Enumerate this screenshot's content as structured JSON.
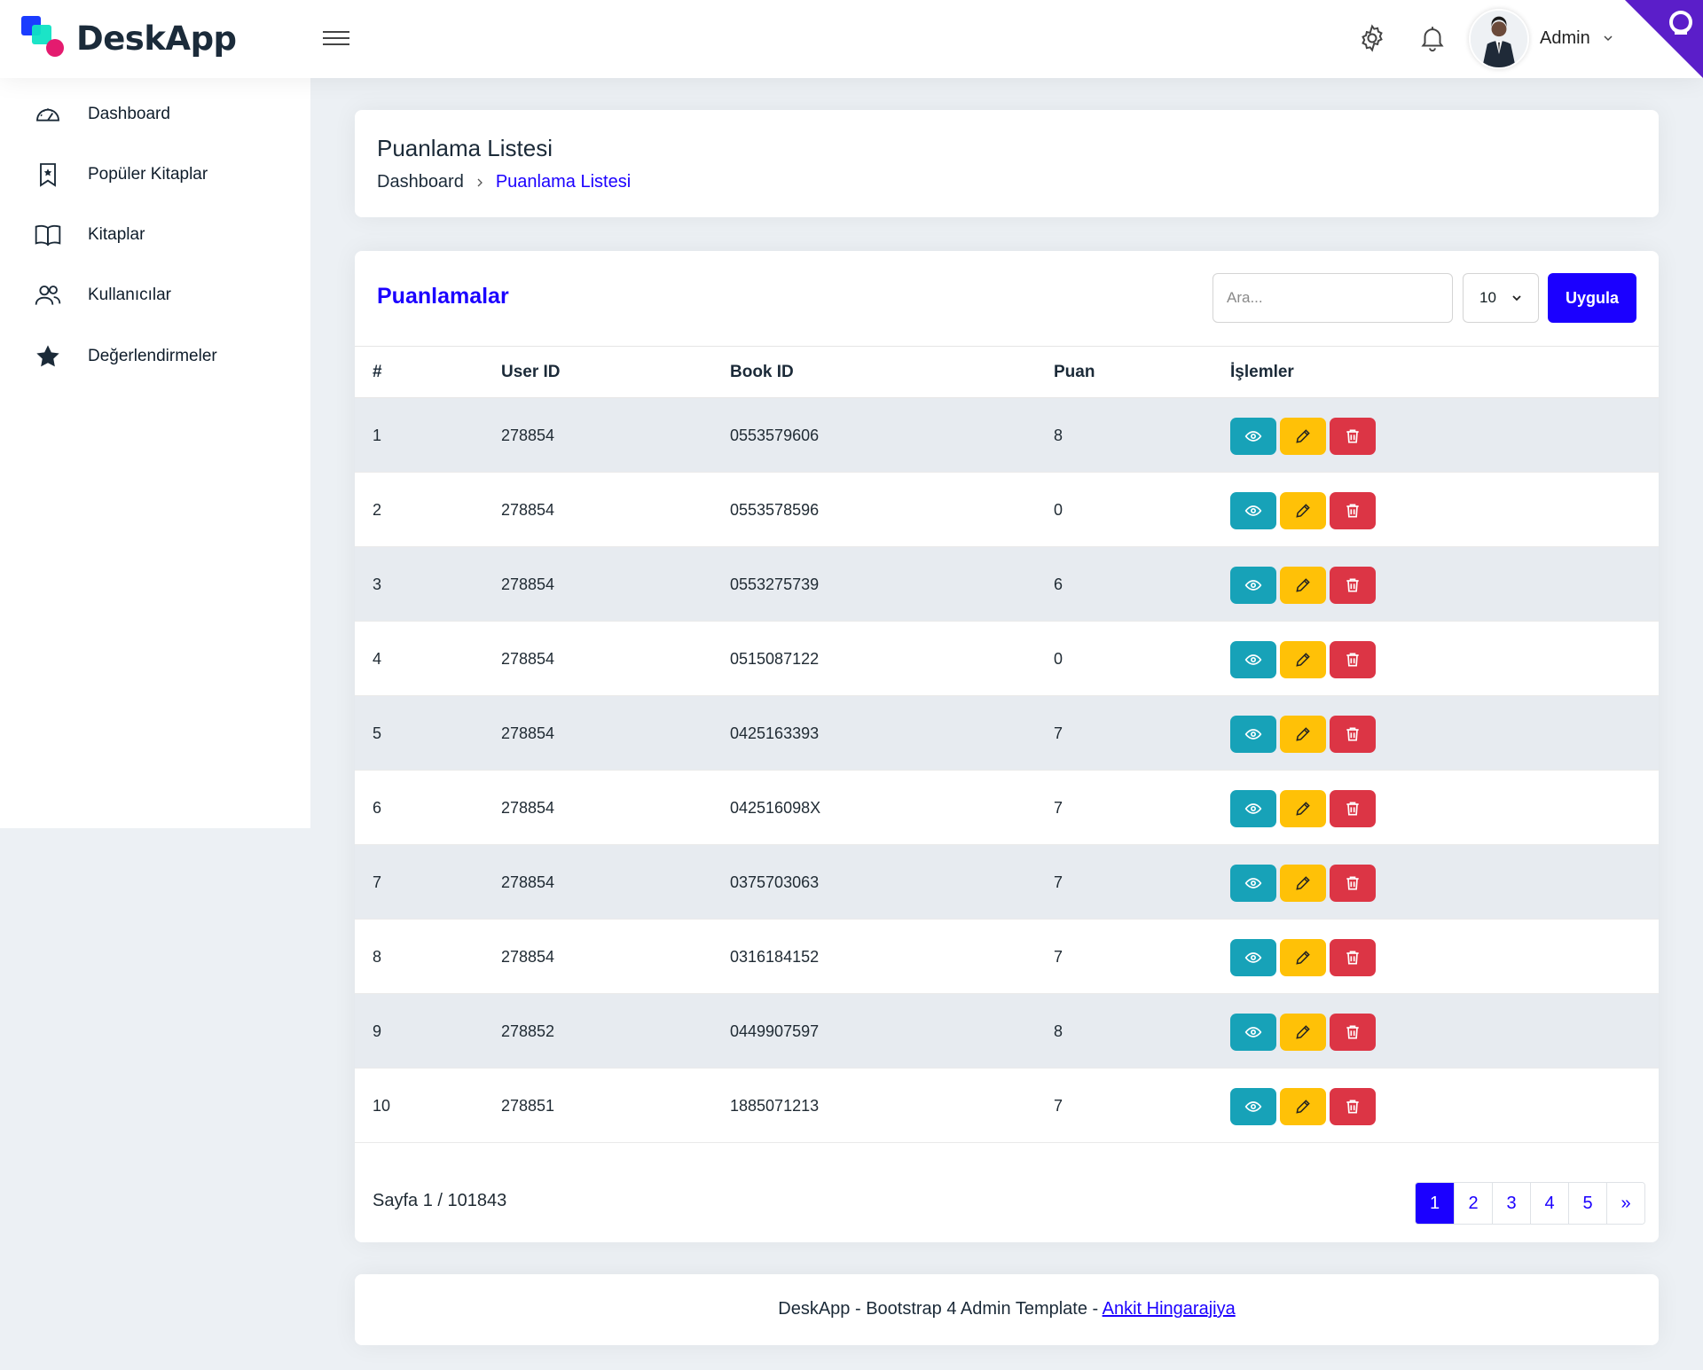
{
  "brand": {
    "name": "DeskApp"
  },
  "header": {
    "user_name": "Admin"
  },
  "sidebar": {
    "items": [
      {
        "label": "Dashboard",
        "icon": "speedometer-icon"
      },
      {
        "label": "Popüler Kitaplar",
        "icon": "bookmark-star-icon"
      },
      {
        "label": "Kitaplar",
        "icon": "book-open-icon"
      },
      {
        "label": "Kullanıcılar",
        "icon": "users-icon"
      },
      {
        "label": "Değerlendirmeler",
        "icon": "star-icon"
      }
    ]
  },
  "page": {
    "title": "Puanlama Listesi",
    "breadcrumb": {
      "home": "Dashboard",
      "active": "Puanlama Listesi"
    }
  },
  "table_card": {
    "title": "Puanlamalar",
    "search_placeholder": "Ara...",
    "per_page": "10",
    "apply_label": "Uygula",
    "columns": [
      "#",
      "User ID",
      "Book ID",
      "Puan",
      "İşlemler"
    ],
    "rows": [
      {
        "n": "1",
        "user_id": "278854",
        "book_id": "0553579606",
        "puan": "8"
      },
      {
        "n": "2",
        "user_id": "278854",
        "book_id": "0553578596",
        "puan": "0"
      },
      {
        "n": "3",
        "user_id": "278854",
        "book_id": "0553275739",
        "puan": "6"
      },
      {
        "n": "4",
        "user_id": "278854",
        "book_id": "0515087122",
        "puan": "0"
      },
      {
        "n": "5",
        "user_id": "278854",
        "book_id": "0425163393",
        "puan": "7"
      },
      {
        "n": "6",
        "user_id": "278854",
        "book_id": "042516098X",
        "puan": "7"
      },
      {
        "n": "7",
        "user_id": "278854",
        "book_id": "0375703063",
        "puan": "7"
      },
      {
        "n": "8",
        "user_id": "278854",
        "book_id": "0316184152",
        "puan": "7"
      },
      {
        "n": "9",
        "user_id": "278852",
        "book_id": "0449907597",
        "puan": "8"
      },
      {
        "n": "10",
        "user_id": "278851",
        "book_id": "1885071213",
        "puan": "7"
      }
    ],
    "page_info": "Sayfa 1 / 101843",
    "pagination": [
      "1",
      "2",
      "3",
      "4",
      "5",
      "»"
    ]
  },
  "footer": {
    "text": "DeskApp - Bootstrap 4 Admin Template - ",
    "link": "Ankit Hingarajiya"
  },
  "colors": {
    "accent": "#1b00ff",
    "view": "#17a2b8",
    "edit": "#ffc107",
    "delete": "#dc3545",
    "background": "#ecf0f4"
  }
}
